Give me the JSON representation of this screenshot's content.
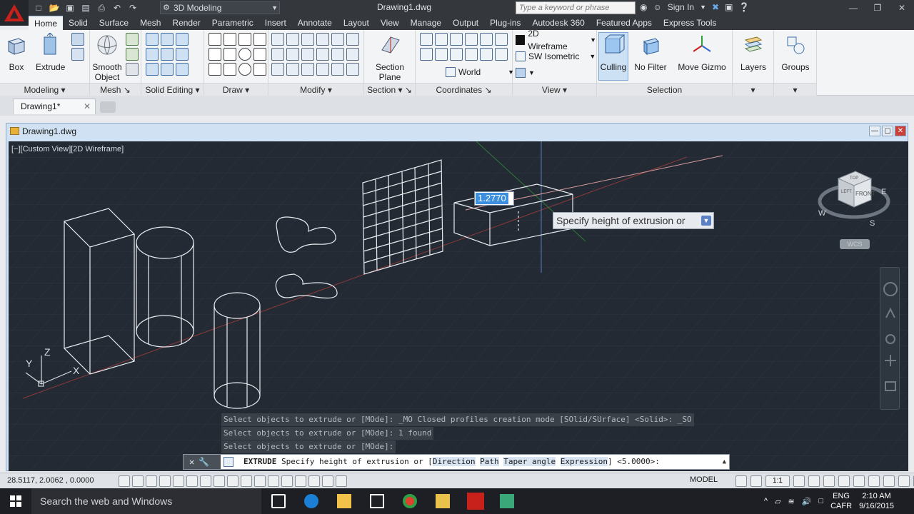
{
  "title_bar": {
    "workspace": "3D Modeling",
    "document_title": "Drawing1.dwg",
    "search_placeholder": "Type a keyword or phrase",
    "sign_in": "Sign In"
  },
  "ribbon_tabs": [
    "Home",
    "Solid",
    "Surface",
    "Mesh",
    "Render",
    "Parametric",
    "Insert",
    "Annotate",
    "Layout",
    "View",
    "Manage",
    "Output",
    "Plug-ins",
    "Autodesk 360",
    "Featured Apps",
    "Express Tools"
  ],
  "ribbon": {
    "modeling": {
      "title": "Modeling",
      "box": "Box",
      "extrude": "Extrude"
    },
    "mesh": {
      "title": "Mesh",
      "smooth_object_line1": "Smooth",
      "smooth_object_line2": "Object"
    },
    "solid_editing": {
      "title": "Solid Editing"
    },
    "draw": {
      "title": "Draw"
    },
    "modify": {
      "title": "Modify"
    },
    "section": {
      "title": "Section",
      "section_plane_line1": "Section",
      "section_plane_line2": "Plane"
    },
    "coordinates": {
      "title": "Coordinates",
      "world": "World"
    },
    "view": {
      "title": "View",
      "visual_style": "2D Wireframe",
      "view_preset": "SW Isometric"
    },
    "selection": {
      "title": "Selection",
      "culling": "Culling",
      "no_filter": "No Filter",
      "move_gizmo": "Move Gizmo"
    },
    "layers": "Layers",
    "groups": "Groups"
  },
  "file_tab": {
    "label": "Drawing1*"
  },
  "drawing_window": {
    "title": "Drawing1.dwg"
  },
  "viewport": {
    "label": "[−][Custom View][2D Wireframe]",
    "dynamic_input_value": "1.2770",
    "tooltip": "Specify height of extrusion or",
    "cube_top": "TOP",
    "cube_front": "FRONT",
    "cube_left": "LEFT",
    "compass_w": "W",
    "compass_s": "S",
    "compass_e": "E",
    "wcs": "WCS",
    "axis_x": "X",
    "axis_y": "Y",
    "axis_z": "Z"
  },
  "command_history": [
    "Select objects to extrude or [MOde]: _MO Closed profiles creation mode [SOlid/SUrface] <Solid>: _SO",
    "Select objects to extrude or [MOde]: 1 found",
    "Select objects to extrude or [MOde]:"
  ],
  "command_line": {
    "command": "EXTRUDE",
    "prompt": "Specify height of extrusion or",
    "options": [
      "Direction",
      "Path",
      "Taper angle",
      "Expression"
    ],
    "default": "<5.0000>:"
  },
  "status_bar": {
    "coordinates": "28.5117, 2.0062 , 0.0000",
    "model": "MODEL",
    "annotation_scale": "1:1"
  },
  "taskbar": {
    "search_placeholder": "Search the web and Windows",
    "language_line1": "ENG",
    "language_line2": "CAFR",
    "time": "2:10 AM",
    "date": "9/16/2015"
  },
  "colors": {
    "viewport_bg": "#232a33",
    "wireframe": "#ffffff",
    "accent_blue": "#3b8fde",
    "app_red": "#c8211b"
  }
}
